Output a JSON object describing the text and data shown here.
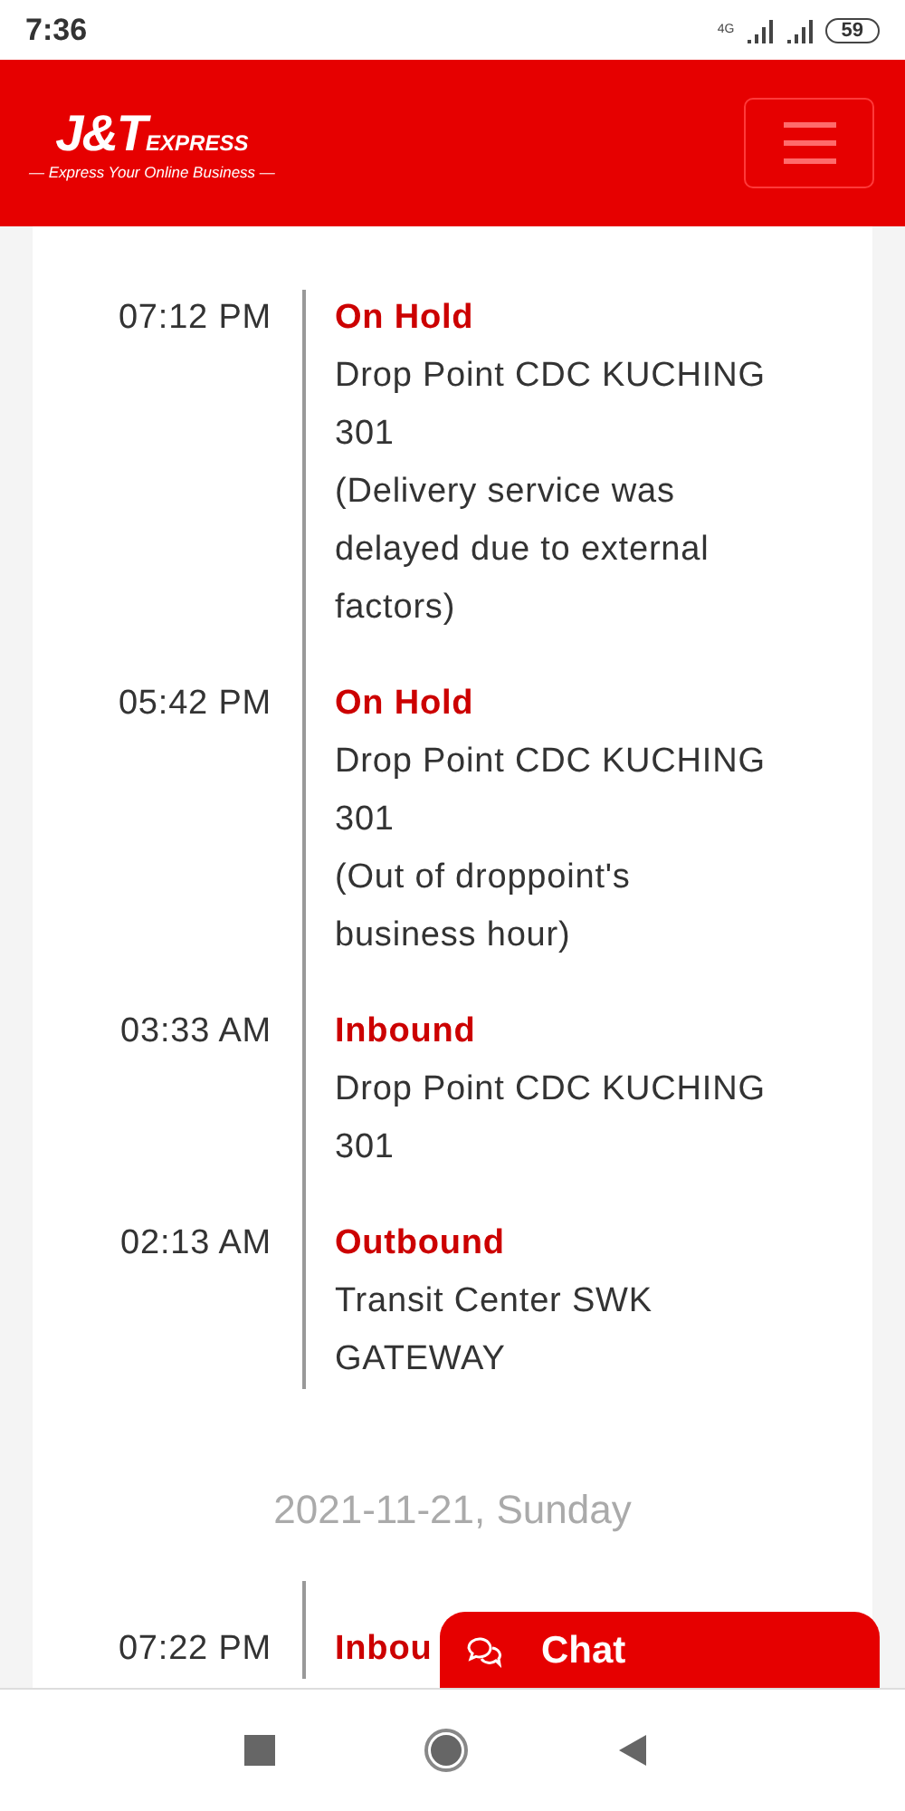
{
  "status_bar": {
    "time": "7:36",
    "network": "4G",
    "battery": "59"
  },
  "header": {
    "logo": "J&T",
    "logo_suffix": "EXPRESS",
    "tagline": "— Express Your Online Business —"
  },
  "days": [
    {
      "entries": [
        {
          "time": "07:12 PM",
          "status": "On Hold",
          "location": "Drop Point CDC KUCHING 301",
          "note": "(Delivery service was delayed due to external factors)"
        },
        {
          "time": "05:42 PM",
          "status": "On Hold",
          "location": "Drop Point CDC KUCHING 301",
          "note": "(Out of droppoint's business hour)"
        },
        {
          "time": "03:33 AM",
          "status": "Inbound",
          "location": "Drop Point CDC KUCHING 301"
        },
        {
          "time": "02:13 AM",
          "status": "Outbound",
          "location": "Transit Center SWK GATEWAY"
        }
      ]
    },
    {
      "date": "2021-11-21, Sunday",
      "entries": [
        {
          "time": "07:22 PM",
          "status": "Inbou"
        }
      ]
    }
  ],
  "chat": {
    "label": "Chat"
  }
}
